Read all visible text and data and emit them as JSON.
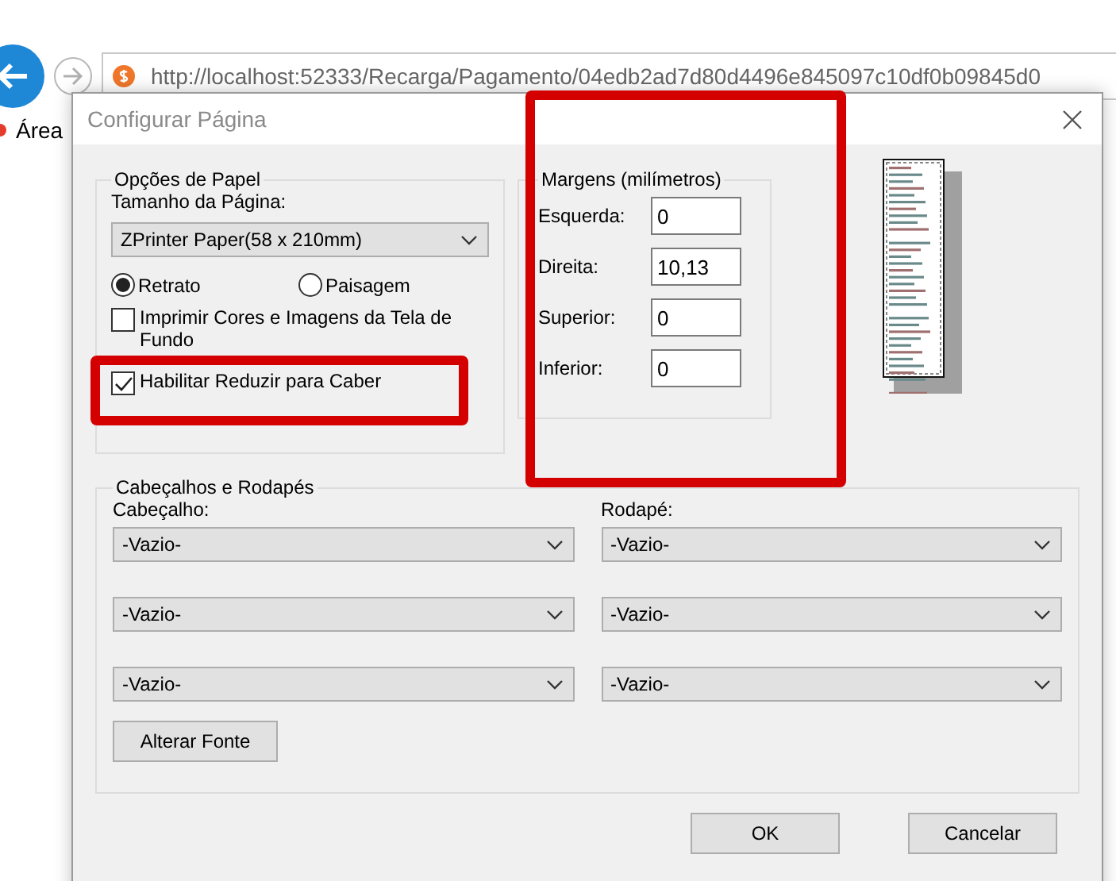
{
  "browser": {
    "url": "http://localhost:52333/Recarga/Pagamento/04edb2ad7d80d4496e845097c10df0b09845d0",
    "favorites": [
      "Área"
    ]
  },
  "dialog": {
    "title": "Configurar Página",
    "paper": {
      "legend": "Opções de Papel",
      "size_label": "Tamanho da Página:",
      "size_value": "ZPrinter Paper(58 x 210mm)",
      "orientations": [
        {
          "label": "Retrato",
          "selected": true
        },
        {
          "label": "Paisagem",
          "selected": false
        }
      ],
      "options": [
        {
          "label": "Imprimir Cores e Imagens da Tela de Fundo",
          "checked": false
        },
        {
          "label": "Habilitar Reduzir para Caber",
          "checked": true
        }
      ]
    },
    "margins": {
      "legend": "Margens (milímetros)",
      "fields": [
        {
          "label": "Esquerda:",
          "value": "0"
        },
        {
          "label": "Direita:",
          "value": "10,13"
        },
        {
          "label": "Superior:",
          "value": "0"
        },
        {
          "label": "Inferior:",
          "value": "0"
        }
      ]
    },
    "headers_footers": {
      "legend": "Cabeçalhos e Rodapés",
      "header_label": "Cabeçalho:",
      "footer_label": "Rodapé:",
      "headers": [
        "-Vazio-",
        "-Vazio-",
        "-Vazio-"
      ],
      "footers": [
        "-Vazio-",
        "-Vazio-",
        "-Vazio-"
      ],
      "font_button": "Alterar Fonte"
    },
    "buttons": [
      "OK",
      "Cancelar"
    ]
  }
}
